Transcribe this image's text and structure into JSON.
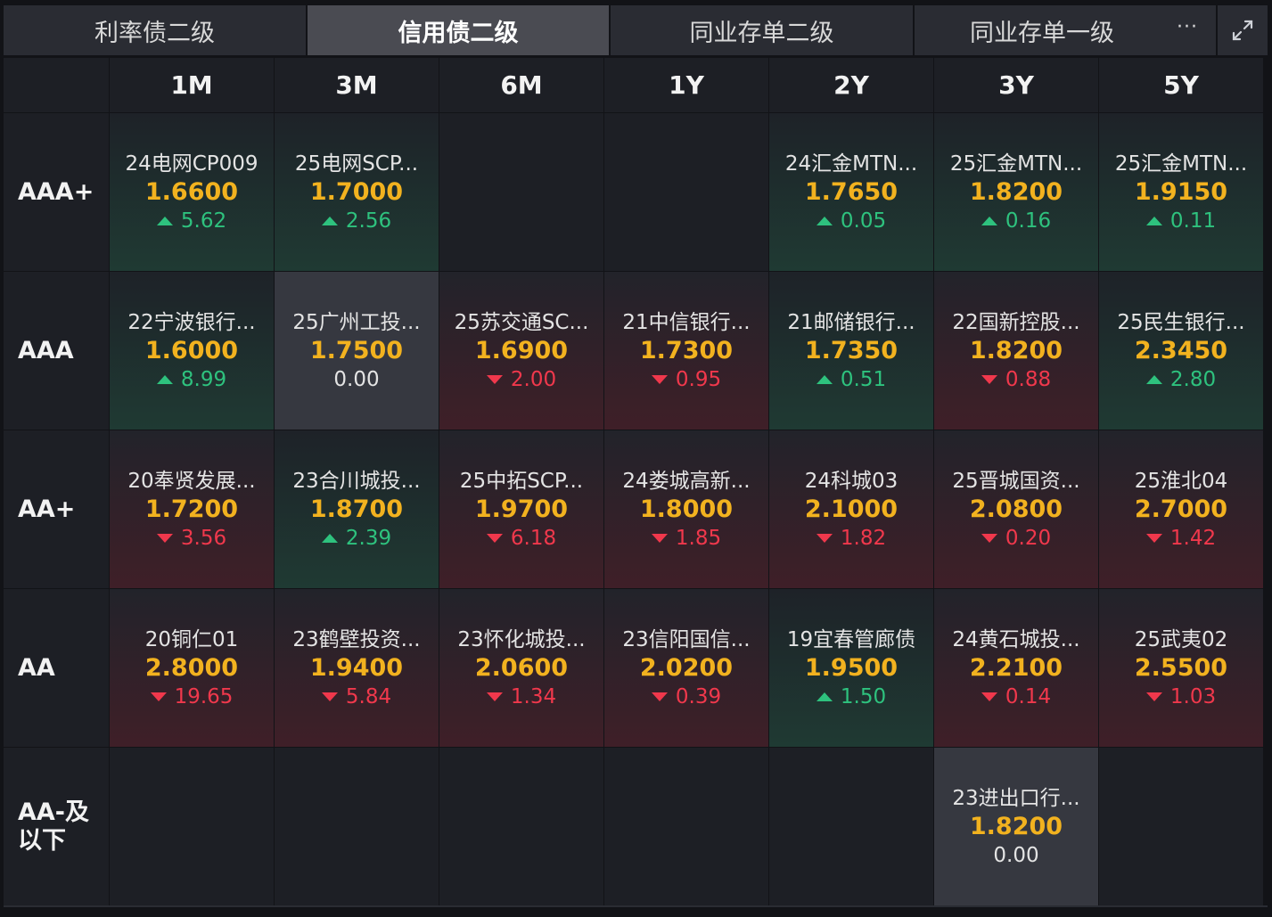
{
  "tabs": [
    {
      "label": "利率债二级",
      "active": false
    },
    {
      "label": "信用债二级",
      "active": true
    },
    {
      "label": "同业存单二级",
      "active": false
    },
    {
      "label": "同业存单一级",
      "active": false
    }
  ],
  "more_label": "···",
  "columns": [
    "1M",
    "3M",
    "6M",
    "1Y",
    "2Y",
    "3Y",
    "5Y"
  ],
  "rows": [
    {
      "label": "AAA+",
      "cells": [
        {
          "name": "24电网CP009",
          "rate": "1.6600",
          "change": "5.62",
          "dir": "up"
        },
        {
          "name": "25电网SCP...",
          "rate": "1.7000",
          "change": "2.56",
          "dir": "up"
        },
        null,
        null,
        {
          "name": "24汇金MTN...",
          "rate": "1.7650",
          "change": "0.05",
          "dir": "up"
        },
        {
          "name": "25汇金MTN...",
          "rate": "1.8200",
          "change": "0.16",
          "dir": "up"
        },
        {
          "name": "25汇金MTN...",
          "rate": "1.9150",
          "change": "0.11",
          "dir": "up"
        }
      ]
    },
    {
      "label": "AAA",
      "cells": [
        {
          "name": "22宁波银行...",
          "rate": "1.6000",
          "change": "8.99",
          "dir": "up"
        },
        {
          "name": "25广州工投...",
          "rate": "1.7500",
          "change": "0.00",
          "dir": "flat"
        },
        {
          "name": "25苏交通SC...",
          "rate": "1.6900",
          "change": "2.00",
          "dir": "down"
        },
        {
          "name": "21中信银行...",
          "rate": "1.7300",
          "change": "0.95",
          "dir": "down"
        },
        {
          "name": "21邮储银行...",
          "rate": "1.7350",
          "change": "0.51",
          "dir": "up"
        },
        {
          "name": "22国新控股...",
          "rate": "1.8200",
          "change": "0.88",
          "dir": "down"
        },
        {
          "name": "25民生银行...",
          "rate": "2.3450",
          "change": "2.80",
          "dir": "up"
        }
      ]
    },
    {
      "label": "AA+",
      "cells": [
        {
          "name": "20奉贤发展...",
          "rate": "1.7200",
          "change": "3.56",
          "dir": "down"
        },
        {
          "name": "23合川城投...",
          "rate": "1.8700",
          "change": "2.39",
          "dir": "up"
        },
        {
          "name": "25中拓SCP...",
          "rate": "1.9700",
          "change": "6.18",
          "dir": "down"
        },
        {
          "name": "24娄城高新...",
          "rate": "1.8000",
          "change": "1.85",
          "dir": "down"
        },
        {
          "name": "24科城03",
          "rate": "2.1000",
          "change": "1.82",
          "dir": "down"
        },
        {
          "name": "25晋城国资...",
          "rate": "2.0800",
          "change": "0.20",
          "dir": "down"
        },
        {
          "name": "25淮北04",
          "rate": "2.7000",
          "change": "1.42",
          "dir": "down"
        }
      ]
    },
    {
      "label": "AA",
      "cells": [
        {
          "name": "20铜仁01",
          "rate": "2.8000",
          "change": "19.65",
          "dir": "down"
        },
        {
          "name": "23鹤壁投资...",
          "rate": "1.9400",
          "change": "5.84",
          "dir": "down"
        },
        {
          "name": "23怀化城投...",
          "rate": "2.0600",
          "change": "1.34",
          "dir": "down"
        },
        {
          "name": "23信阳国信...",
          "rate": "2.0200",
          "change": "0.39",
          "dir": "down"
        },
        {
          "name": "19宜春管廊债",
          "rate": "1.9500",
          "change": "1.50",
          "dir": "up"
        },
        {
          "name": "24黄石城投...",
          "rate": "2.2100",
          "change": "0.14",
          "dir": "down"
        },
        {
          "name": "25武夷02",
          "rate": "2.5500",
          "change": "1.03",
          "dir": "down"
        }
      ]
    },
    {
      "label": "AA-及以下",
      "cells": [
        null,
        null,
        null,
        null,
        null,
        {
          "name": "23进出口行...",
          "rate": "1.8200",
          "change": "0.00",
          "dir": "flat"
        },
        null
      ]
    }
  ],
  "colors": {
    "rate": "#f2b21f",
    "up": "#2ec27e",
    "down": "#f0384c",
    "background": "#121317"
  }
}
